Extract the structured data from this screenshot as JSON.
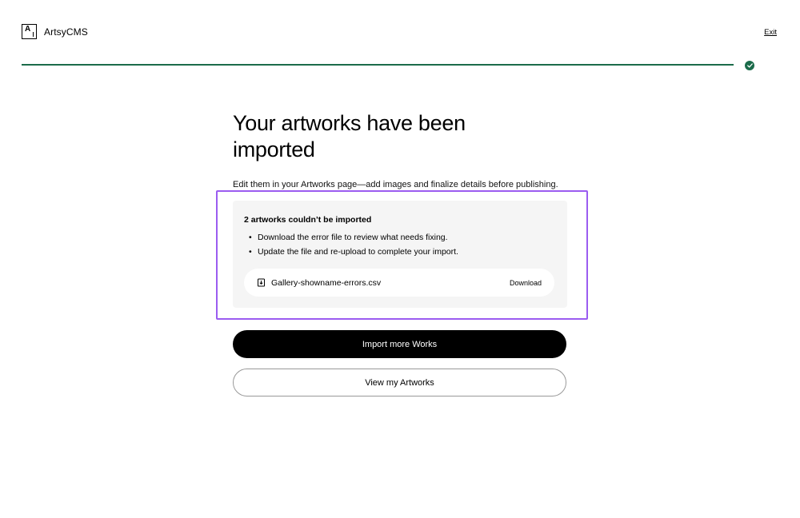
{
  "header": {
    "logo_letter": "A",
    "app_name": "ArtsyCMS",
    "exit_label": "Exit"
  },
  "progress": {
    "percent": 100,
    "accent_color": "#1b6b4a",
    "complete_icon": "check-circle-icon"
  },
  "main": {
    "title": "Your artworks have been imported",
    "subtitle": "Edit them in your Artworks page—add images and finalize details before publishing."
  },
  "errors": {
    "title": "2 artworks couldn’t be imported",
    "items": [
      "Download the error file to review what needs fixing.",
      "Update the file and re-upload to complete your import."
    ],
    "file": {
      "icon": "file-download-icon",
      "name": "Gallery-showname-errors.csv",
      "action": "Download"
    },
    "highlight_color": "#9b5cf0"
  },
  "actions": {
    "primary": "Import more Works",
    "secondary": "View my Artworks"
  }
}
